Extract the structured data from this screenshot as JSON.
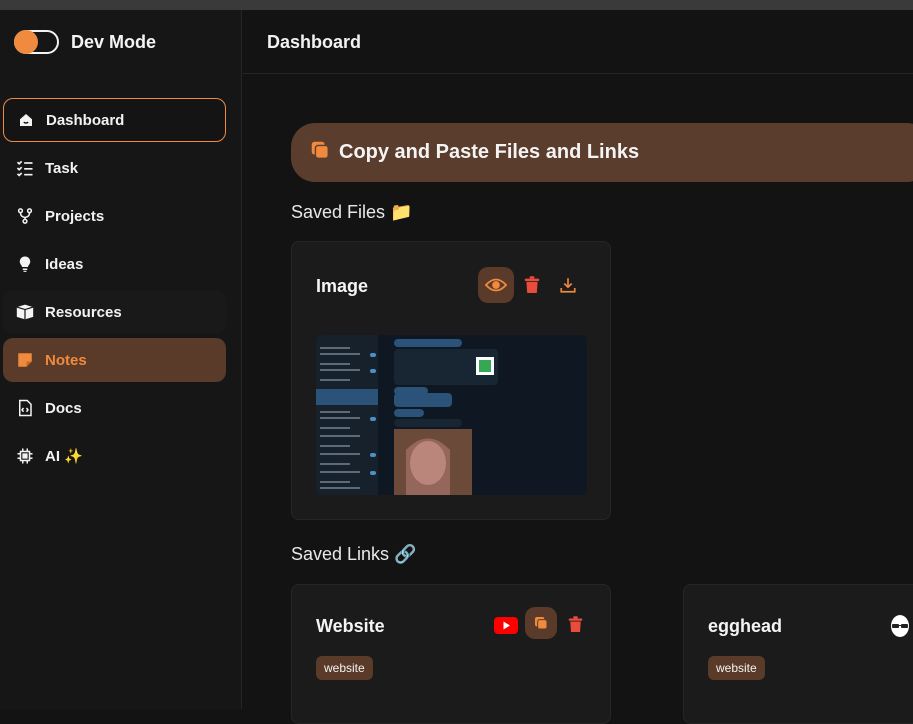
{
  "app": {
    "name": "Dev Mode"
  },
  "header": {
    "title": "Dashboard"
  },
  "sidebar": {
    "items": [
      {
        "label": "Dashboard",
        "icon": "home-icon"
      },
      {
        "label": "Task",
        "icon": "checklist-icon"
      },
      {
        "label": "Projects",
        "icon": "branch-icon"
      },
      {
        "label": "Ideas",
        "icon": "lightbulb-icon"
      },
      {
        "label": "Resources",
        "icon": "box-icon"
      },
      {
        "label": "Notes",
        "icon": "note-icon"
      },
      {
        "label": "Docs",
        "icon": "file-code-icon"
      },
      {
        "label": "AI ✨",
        "icon": "chip-icon"
      }
    ]
  },
  "banner": {
    "title": "Copy and Paste Files and Links"
  },
  "saved_files": {
    "title": "Saved Files 📁",
    "cards": [
      {
        "title": "Image"
      }
    ]
  },
  "saved_links": {
    "title": "Saved Links 🔗",
    "cards": [
      {
        "title": "Website",
        "tag": "website"
      },
      {
        "title": "egghead",
        "tag": "website"
      }
    ]
  },
  "colors": {
    "accent": "#f08a3e",
    "accent_bg": "#5a3a28",
    "danger": "#e74c3c",
    "background": "#131313"
  }
}
